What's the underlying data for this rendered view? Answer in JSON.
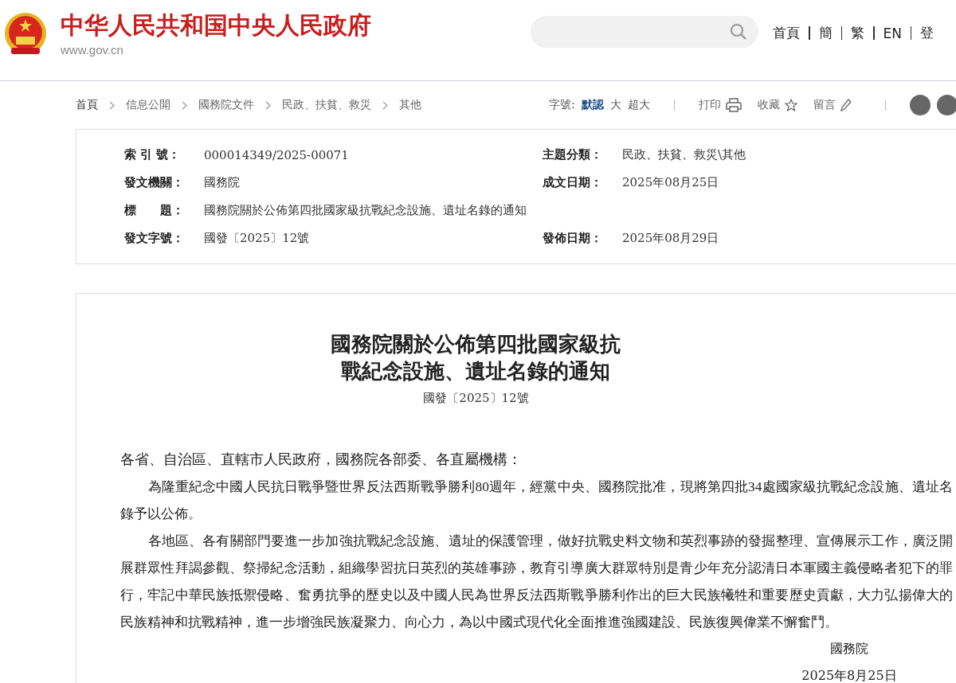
{
  "header": {
    "site_title": "中华人民共和国中央人民政府",
    "site_url": "www.gov.cn",
    "nav": [
      "首頁",
      "簡",
      "繁",
      "EN",
      "登"
    ]
  },
  "breadcrumb": [
    "首頁",
    "信息公開",
    "國務院文件",
    "民政、扶貧、救災",
    "其他"
  ],
  "tools": {
    "font_label": "字號:",
    "font_sizes": [
      {
        "label": "默認",
        "selected": true
      },
      {
        "label": "大",
        "selected": false
      },
      {
        "label": "超大",
        "selected": false
      }
    ],
    "actions": [
      {
        "label": "打印",
        "kind": "print"
      },
      {
        "label": "收藏",
        "kind": "star"
      },
      {
        "label": "留言",
        "kind": "pencil"
      }
    ]
  },
  "meta": [
    {
      "label": "索 引 號：",
      "value": "000014349/2025-00071",
      "label_2": "主題分類：",
      "value_2": "民政、扶貧、救災\\其他"
    },
    {
      "label": "發文機關：",
      "value": "國務院",
      "label_2": "成文日期：",
      "value_2": "2025年08月25日"
    },
    {
      "label": "標　　題：",
      "value": "國務院關於公佈第四批國家級抗戰紀念設施、遺址名錄的通知"
    },
    {
      "label": "發文字號：",
      "value": "國發〔2025〕12號",
      "label_2": "發佈日期：",
      "value_2": "2025年08月29日"
    }
  ],
  "document": {
    "title": "國務院關於公佈第四批國家級抗戰紀念設施、遺址名錄的通知",
    "doc_number": "國發〔2025〕12號",
    "addressee": "各省、自治區、直轄市人民政府，國務院各部委、各直屬機構：",
    "paragraphs": [
      "為隆重紀念中國人民抗日戰爭暨世界反法西斯戰爭勝利80週年，經黨中央、國務院批准，現將第四批34處國家級抗戰紀念設施、遺址名錄予以公佈。",
      "各地區、各有關部門要進一步加強抗戰紀念設施、遺址的保護管理，做好抗戰史料文物和英烈事跡的發掘整理、宣傳展示工作，廣泛開展群眾性拜謁參觀、祭掃紀念活動，組織學習抗日英烈的英雄事跡，教育引導廣大群眾特別是青少年充分認清日本軍國主義侵略者犯下的罪行，牢記中華民族抵禦侵略、奮勇抗爭的歷史以及中國人民為世界反法西斯戰爭勝利作出的巨大民族犧牲和重要歷史貢獻，大力弘揚偉大的民族精神和抗戰精神，進一步增強民族凝聚力、向心力，為以中國式現代化全面推進強國建設、民族復興偉業不懈奮鬥。"
    ],
    "signature": "國務院",
    "date": "2025年8月25日"
  }
}
